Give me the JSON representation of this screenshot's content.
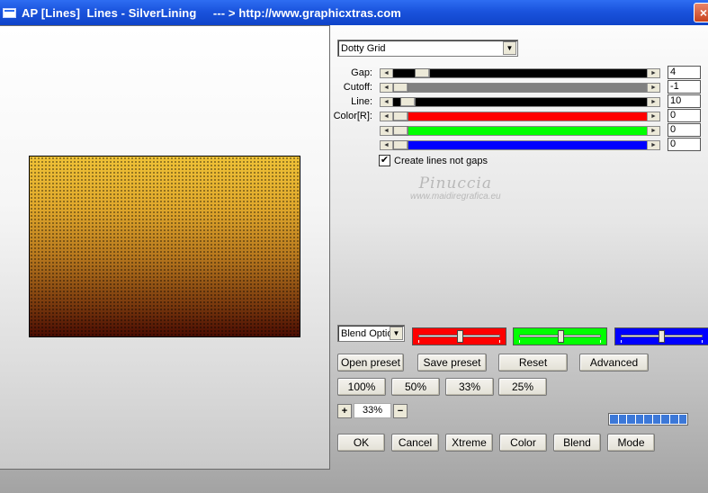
{
  "window": {
    "title": "AP [Lines]  Lines - SilverLining     --- > http://www.graphicxtras.com"
  },
  "preset_select": {
    "value": "Dotty Grid"
  },
  "params": [
    {
      "label": "Gap:",
      "value": "4",
      "fill_color": "#000000",
      "thumb_fraction": 0.09,
      "dark_lead": 0.04
    },
    {
      "label": "Cutoff:",
      "value": "-1",
      "fill_color": "#808080",
      "thumb_fraction": 0.0,
      "dark_lead": 0.0
    },
    {
      "label": "Line:",
      "value": "10",
      "fill_color": "#000000",
      "thumb_fraction": 0.03,
      "dark_lead": 0.02
    },
    {
      "label": "Color[R]:",
      "value": "0",
      "fill_color": "#ff0000",
      "thumb_fraction": 0.0,
      "dark_lead": 0.0
    },
    {
      "label": "",
      "value": "0",
      "fill_color": "#00ff00",
      "thumb_fraction": 0.0,
      "dark_lead": 0.0
    },
    {
      "label": "",
      "value": "0",
      "fill_color": "#0000ff",
      "thumb_fraction": 0.0,
      "dark_lead": 0.0
    }
  ],
  "checkbox": {
    "label": "Create lines not gaps",
    "checked": true,
    "mark": "✔"
  },
  "watermark": {
    "name": "Pinuccia",
    "url": "www.maidiregrafica.eu"
  },
  "blend_select": {
    "value": "Blend Optio"
  },
  "color_sliders": [
    {
      "color": "#ff0000",
      "position": 0.5
    },
    {
      "color": "#00ff00",
      "position": 0.5
    },
    {
      "color": "#0000ff",
      "position": 0.5
    }
  ],
  "buttons_row1": {
    "open": "Open preset",
    "save": "Save preset",
    "reset": "Reset",
    "advanced": "Advanced"
  },
  "zoom_presets": {
    "z100": "100%",
    "z50": "50%",
    "z33": "33%",
    "z25": "25%"
  },
  "zoom": {
    "plus": "+",
    "value": "33%",
    "minus": "−"
  },
  "progress": {
    "segments": 9,
    "filled": 9
  },
  "buttons_bottom": {
    "ok": "OK",
    "cancel": "Cancel",
    "xtreme": "Xtreme",
    "color": "Color",
    "blend": "Blend",
    "mode": "Mode"
  },
  "icons": {
    "close": "×",
    "dropdown": "▼",
    "left": "◄",
    "right": "►"
  }
}
